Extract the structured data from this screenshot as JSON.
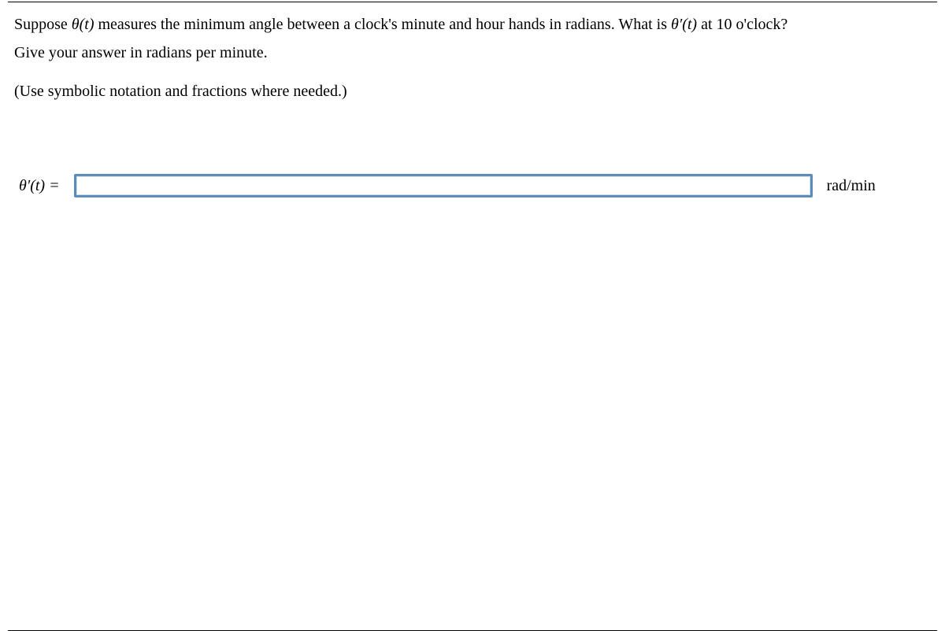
{
  "question": {
    "line1_prefix": "Suppose ",
    "theta_t": "θ(t)",
    "line1_mid": " measures the minimum angle between a clock's minute and hour hands in radians. What is ",
    "theta_prime_t": "θ′(t)",
    "line1_suffix": " at 10 o'clock?",
    "line2": "Give your answer in radians per minute.",
    "hint": "(Use symbolic notation and fractions where needed.)"
  },
  "answer": {
    "label_theta_prime": "θ′(t) =",
    "input_value": "",
    "unit": "rad/min"
  }
}
